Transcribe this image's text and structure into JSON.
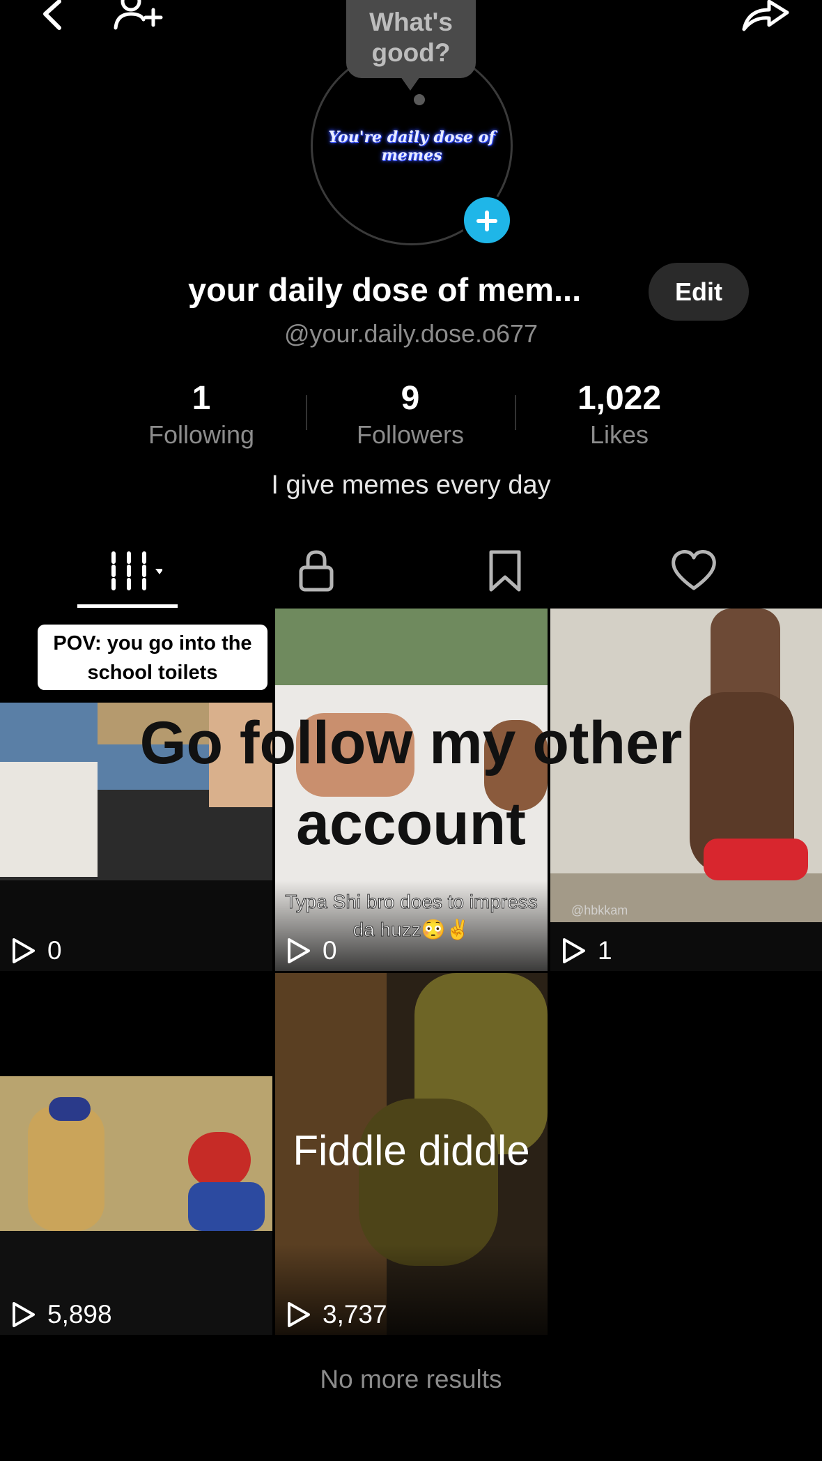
{
  "bubble": {
    "line1": "What's",
    "line2": "good?"
  },
  "avatar": {
    "text": "You're daily dose of memes"
  },
  "profile": {
    "display_name": "your daily dose of mem...",
    "edit_label": "Edit",
    "username": "@your.daily.dose.o677",
    "bio": "I give memes every day"
  },
  "stats": [
    {
      "value": "1",
      "label": "Following"
    },
    {
      "value": "9",
      "label": "Followers"
    },
    {
      "value": "1,022",
      "label": "Likes"
    }
  ],
  "tabs": [
    "videos-icon",
    "lock-icon",
    "bookmark-icon",
    "heart-icon"
  ],
  "videos": [
    {
      "views": "0",
      "caption": "POV: you go into the school toilets"
    },
    {
      "views": "0",
      "caption": "Typa Shi bro does to impress da huzz😳✌️"
    },
    {
      "views": "1",
      "caption": "@hbkkam"
    },
    {
      "views": "5,898",
      "caption": ""
    },
    {
      "views": "3,737",
      "caption": "Fiddle diddle"
    }
  ],
  "overlay_text": "Go follow my other account",
  "footer": {
    "no_more": "No more results"
  }
}
